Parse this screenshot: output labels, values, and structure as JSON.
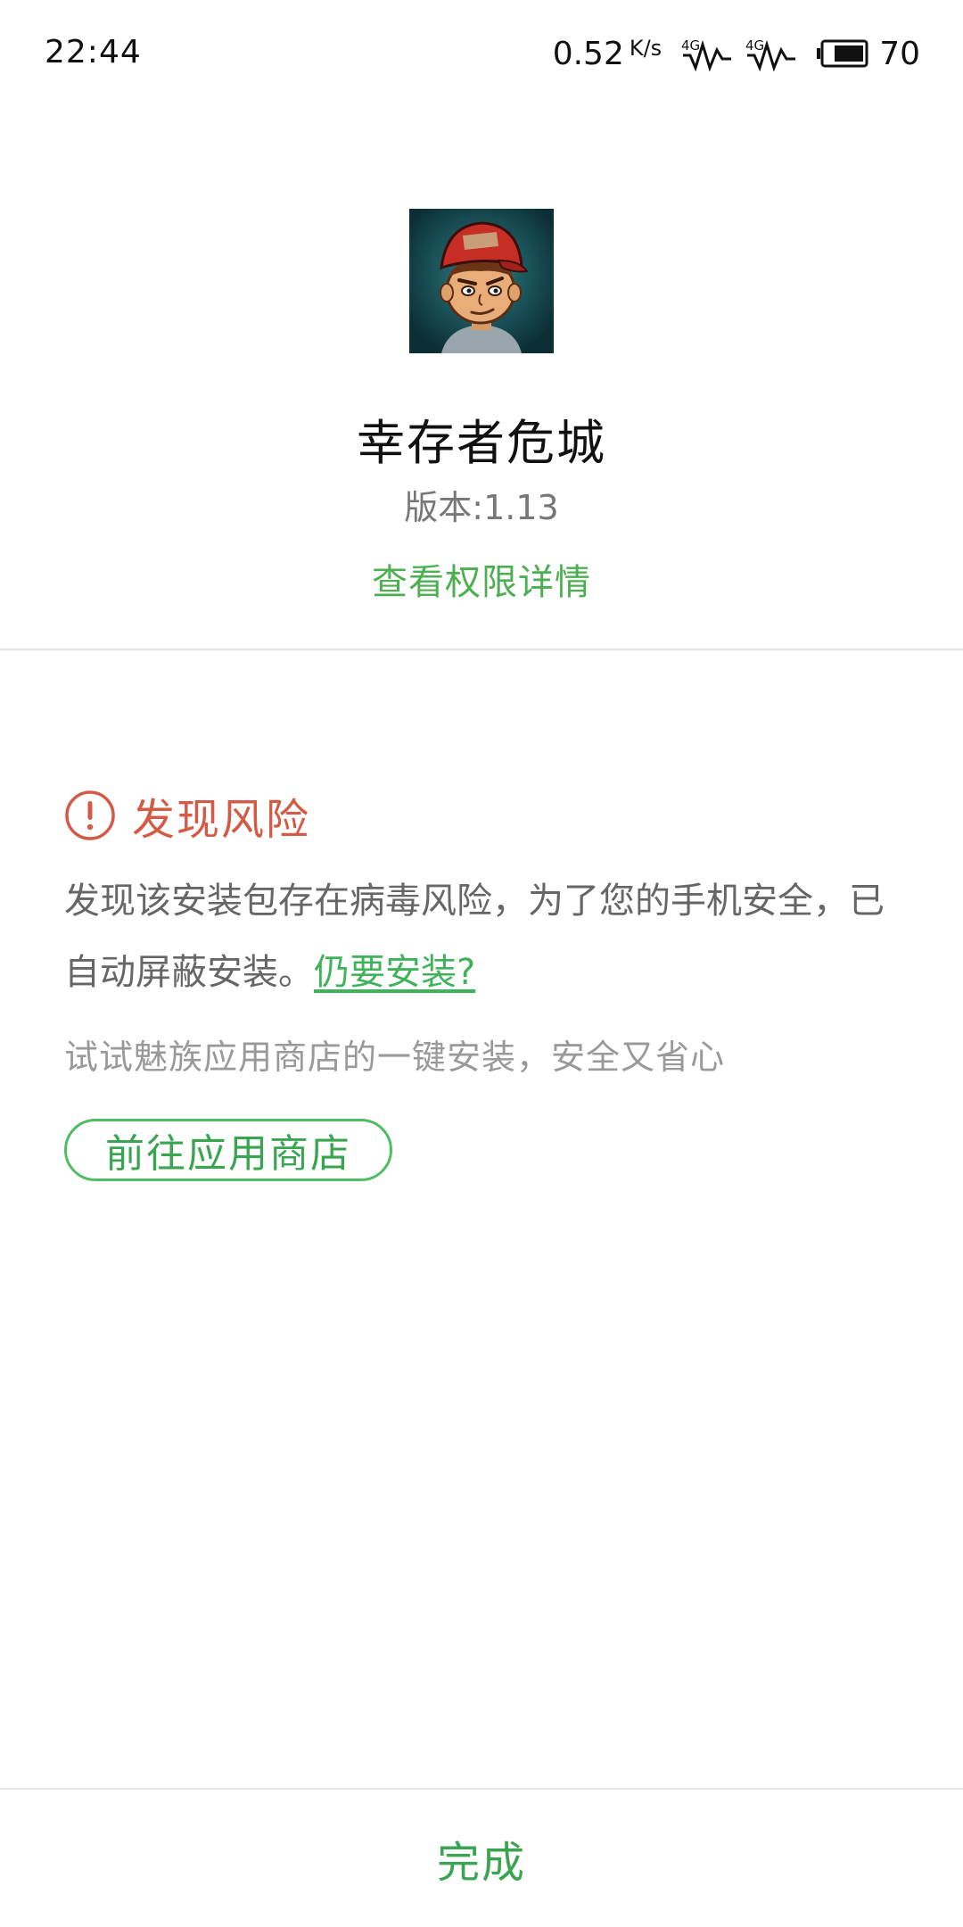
{
  "status_bar": {
    "time": "22:44",
    "net_speed": "0.52",
    "net_unit": "K/s",
    "signal_1": "4G",
    "signal_2": "4G",
    "battery": "70"
  },
  "app": {
    "icon": "survivor-character-app-icon",
    "name": "幸存者危城",
    "version_label": "版本:",
    "version": "1.13",
    "permissions_link": "查看权限详情"
  },
  "risk": {
    "icon": "warning-circle-icon",
    "title": "发现风险",
    "description": "发现该安装包存在病毒风险，为了您的手机安全，已自动屏蔽安装。",
    "install_anyway_link": "仍要安装?",
    "store_hint": "试试魅族应用商店的一键安装，安全又省心",
    "store_button": "前往应用商店"
  },
  "footer": {
    "done_button": "完成"
  },
  "colors": {
    "accent_green": "#4caf50",
    "warning_red": "#d35a44",
    "text_gray": "#666666"
  }
}
